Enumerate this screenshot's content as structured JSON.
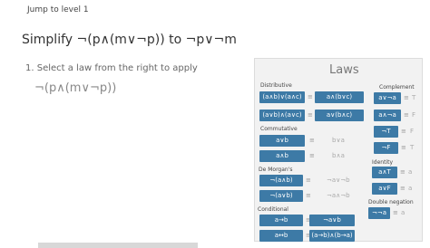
{
  "header": {
    "jump_link": "Jump to level 1"
  },
  "title": "Simplify ¬(p∧(m∨¬p)) to ¬p∨¬m",
  "instruction": "1. Select a law from the right to apply",
  "current_expression": "¬(p∧(m∨¬p))",
  "laws_panel": {
    "title": "Laws",
    "equals_symbol": "≡",
    "sections": {
      "distributive": "Distributive",
      "commutative": "Commutative",
      "de_morgans": "De Morgan's",
      "conditional": "Conditional",
      "complement": "Complement",
      "identity": "Identity",
      "double_negation": "Double negation"
    },
    "rules": {
      "dist1_left": "(a∧b)∨(a∧c)",
      "dist1_right": "a∧(b∨c)",
      "dist2_left": "(a∨b)∧(a∨c)",
      "dist2_right": "a∨(b∧c)",
      "comm1_left": "a∨b",
      "comm1_right": "b∨a",
      "comm2_left": "a∧b",
      "comm2_right": "b∧a",
      "dm1_left": "¬(a∧b)",
      "dm1_right": "¬a∨¬b",
      "dm2_left": "¬(a∨b)",
      "dm2_right": "¬a∧¬b",
      "cond1_left": "a→b",
      "cond1_right": "¬a∨b",
      "cond2_left": "a↔b",
      "cond2_right": "(a→b)∧(b→a)",
      "comp1_left": "a∨¬a",
      "comp1_right": "T",
      "comp2_left": "a∧¬a",
      "comp2_right": "F",
      "comp3_left": "¬T",
      "comp3_right": "F",
      "comp4_left": "¬F",
      "comp4_right": "T",
      "id1_left": "a∧T",
      "id1_right": "a",
      "id2_left": "a∨F",
      "id2_right": "a",
      "dn_left": "¬¬a",
      "dn_right": "a"
    }
  }
}
